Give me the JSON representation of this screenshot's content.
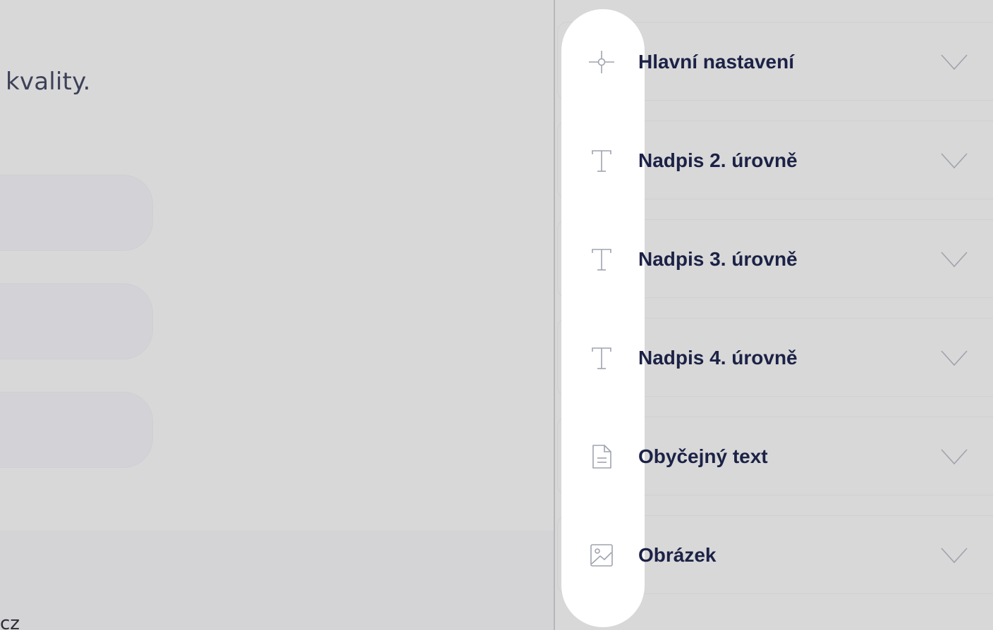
{
  "preview": {
    "text": "kvality.",
    "footer_text": "cz"
  },
  "panel": {
    "sections": [
      {
        "label": "Hlavní nastavení",
        "icon": "crosshair-icon"
      },
      {
        "label": "Nadpis 2. úrovně",
        "icon": "text-icon"
      },
      {
        "label": "Nadpis 3. úrovně",
        "icon": "text-icon"
      },
      {
        "label": "Nadpis 4. úrovně",
        "icon": "text-icon"
      },
      {
        "label": "Obyčejný text",
        "icon": "document-icon"
      },
      {
        "label": "Obrázek",
        "icon": "image-icon"
      }
    ]
  },
  "colors": {
    "background": "#d8d8d8",
    "label": "#1c2246",
    "icon": "#a0a3ad",
    "strip": "#ffffff"
  }
}
